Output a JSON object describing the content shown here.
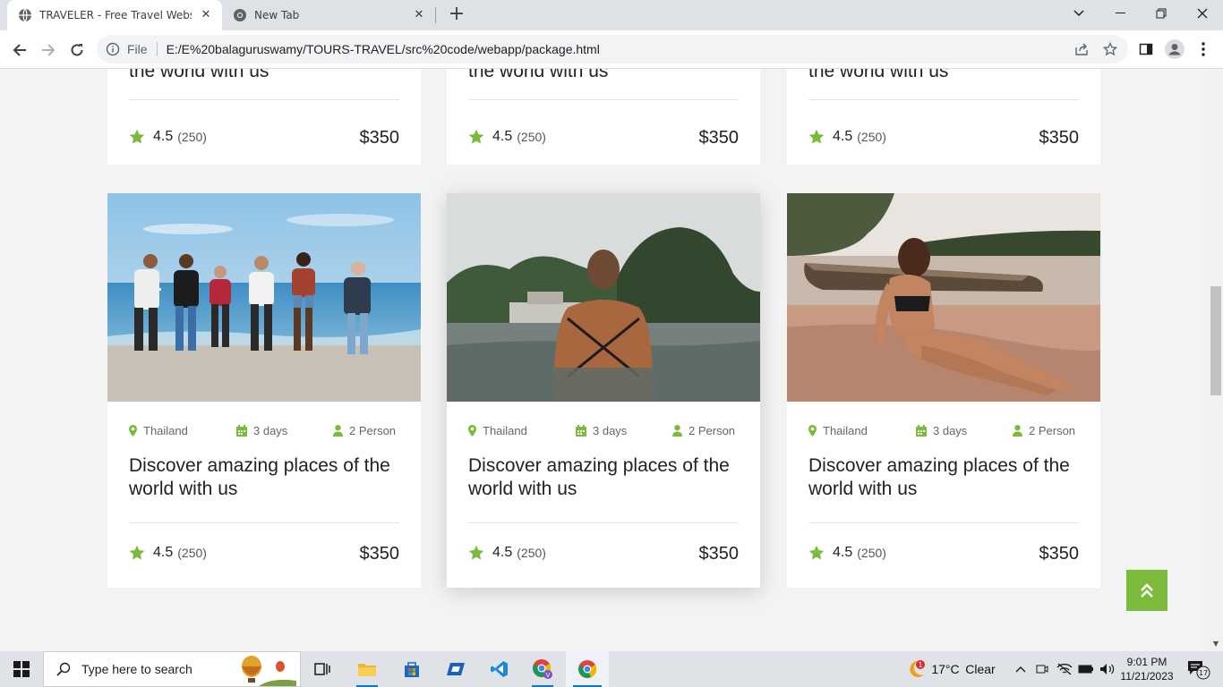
{
  "browser": {
    "tabs": [
      {
        "title": "TRAVELER - Free Travel Website",
        "icon": "globe-icon",
        "active": true
      },
      {
        "title": "New Tab",
        "icon": "chrome-icon",
        "active": false
      }
    ],
    "scheme": "File",
    "url": "E:/E%20balaguruswamy/TOURS-TRAVEL/src%20code/webapp/package.html"
  },
  "colors": {
    "accent": "#7cba3b",
    "text": "#222222",
    "muted": "#666666"
  },
  "top_row": [
    {
      "title_fragment": "the world with us",
      "score": "4.5",
      "count": "(250)",
      "price": "$350"
    },
    {
      "title_fragment": "the world with us",
      "score": "4.5",
      "count": "(250)",
      "price": "$350"
    },
    {
      "title_fragment": "the world with us",
      "score": "4.5",
      "count": "(250)",
      "price": "$350"
    }
  ],
  "packages": [
    {
      "location": "Thailand",
      "duration": "3 days",
      "people": "2 Person",
      "title": "Discover amazing places of the world with us",
      "score": "4.5",
      "count": "(250)",
      "price": "$350",
      "image": "group-on-beach-photo"
    },
    {
      "location": "Thailand",
      "duration": "3 days",
      "people": "2 Person",
      "title": "Discover amazing places of the world with us",
      "score": "4.5",
      "count": "(250)",
      "price": "$350",
      "image": "swimmer-bay-photo"
    },
    {
      "location": "Thailand",
      "duration": "3 days",
      "people": "2 Person",
      "title": "Discover amazing places of the world with us",
      "score": "4.5",
      "count": "(250)",
      "price": "$350",
      "image": "woman-on-sand-photo"
    }
  ],
  "taskbar": {
    "search_placeholder": "Type here to search",
    "temperature": "17°C",
    "weather": "Clear",
    "weather_badge": "1",
    "time": "9:01 PM",
    "date": "11/21/2023",
    "notifications": "17"
  }
}
